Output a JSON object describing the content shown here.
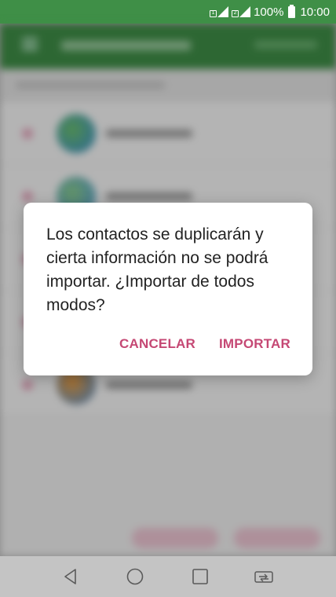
{
  "status_bar": {
    "sim1": "1",
    "sim2": "2",
    "battery": "100%",
    "time": "10:00"
  },
  "dialog": {
    "message": "Los contactos se duplicarán y cierta información no se podrá importar. ¿Importar de todos modos?",
    "cancel_label": "CANCELAR",
    "import_label": "IMPORTAR"
  },
  "navigation": {
    "back": "back-icon",
    "home": "home-icon",
    "recents": "recents-icon",
    "dual_window": "dual-window-icon"
  },
  "colors": {
    "header_green": "#3f8f47",
    "accent_pink": "#c54874"
  }
}
